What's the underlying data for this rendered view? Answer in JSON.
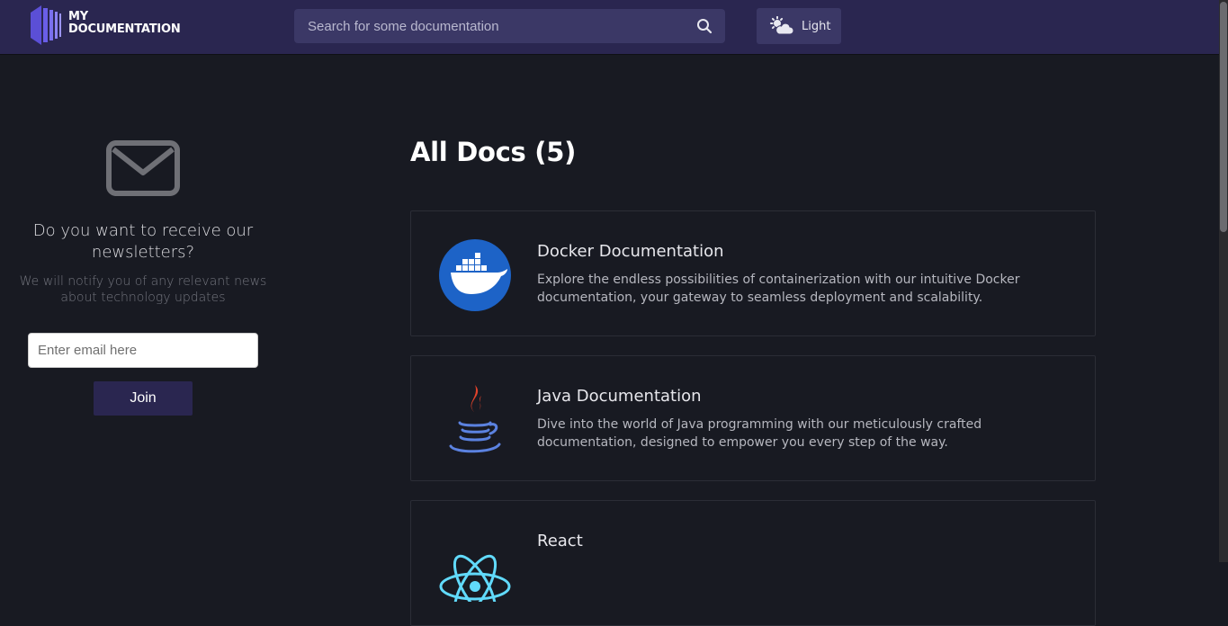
{
  "header": {
    "logo_line1": "MY",
    "logo_line2": "DOCUMENTATION",
    "search": {
      "placeholder": "Search for some documentation",
      "value": ""
    },
    "theme_toggle_label": "Light"
  },
  "newsletter": {
    "title": "Do you want to receive our newsletters?",
    "subtitle": "We will notify you of any relevant news about technology updates",
    "email_placeholder": "Enter email here",
    "join_label": "Join"
  },
  "main": {
    "title": "All Docs (5)",
    "cards": [
      {
        "title": "Docker Documentation",
        "description": "Explore the endless possibilities of containerization with our intuitive Docker documentation, your gateway to seamless deployment and scalability.",
        "icon": "docker-icon"
      },
      {
        "title": "Java Documentation",
        "description": "Dive into the world of Java programming with our meticulously crafted documentation, designed to empower you every step of the way.",
        "icon": "java-icon"
      },
      {
        "title": "React",
        "description": "",
        "icon": "react-icon"
      }
    ]
  },
  "colors": {
    "header_bg": "#2a2650",
    "page_bg": "#181a22",
    "accent": "#3b3866",
    "docker_blue": "#1d63c7"
  }
}
